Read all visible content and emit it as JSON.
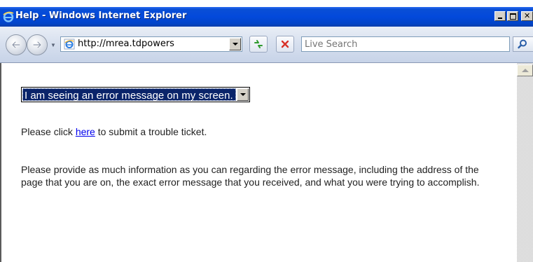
{
  "window": {
    "title": "Help - Windows Internet Explorer"
  },
  "toolbar": {
    "address_url": "http://mrea.tdpowers",
    "search_placeholder": "Live Search"
  },
  "content": {
    "topic_selected": "I am seeing an error message on my screen.",
    "ticket_prefix": "Please click ",
    "ticket_link": "here",
    "ticket_suffix": " to submit a trouble ticket.",
    "instructions": "Please provide as much information as you can regarding the error message, including the address of the page that you are on, the exact error message that you received, and what you were trying to accomplish."
  },
  "colors": {
    "titlebar": "#0349db",
    "link": "#0000ee",
    "selection": "#0a246a"
  },
  "icons": [
    "ie-logo-icon",
    "minimize-icon",
    "maximize-icon",
    "close-icon",
    "back-arrow-icon",
    "forward-arrow-icon",
    "dropdown-arrow-icon",
    "page-icon",
    "refresh-icon",
    "stop-icon",
    "search-icon",
    "scroll-up-arrow-icon"
  ]
}
